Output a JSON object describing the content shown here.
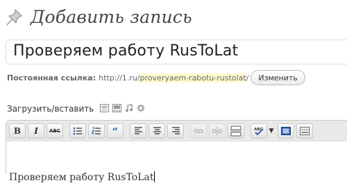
{
  "page": {
    "heading": "Добавить запись",
    "heading_icon": "pushpin-icon"
  },
  "post": {
    "title": "Проверяем работу RusToLat"
  },
  "permalink": {
    "label": "Постоянная ссылка:",
    "base": "http://1.ru/",
    "slug": "proveryaem-rabotu-rustolat",
    "suffix": "/",
    "change_button": "Изменить",
    "slug_highlight_color": "#fffbcc"
  },
  "media": {
    "label": "Загрузить/вставить",
    "icons": [
      "add-image-icon",
      "add-video-icon",
      "add-audio-icon",
      "add-media-icon"
    ]
  },
  "toolbar": {
    "bold": "B",
    "italic": "I",
    "strikethrough": "ABC",
    "buttons": [
      "bold-button",
      "italic-button",
      "strikethrough-button",
      "bullet-list-button",
      "numbered-list-button",
      "blockquote-button",
      "align-left-button",
      "align-center-button",
      "align-right-button",
      "insert-link-button",
      "remove-link-button",
      "insert-more-button",
      "spellcheck-button",
      "spellcheck-dropdown",
      "fullscreen-button",
      "kitchen-sink-button"
    ]
  },
  "editor": {
    "content": "Проверяем работу RusToLat"
  }
}
